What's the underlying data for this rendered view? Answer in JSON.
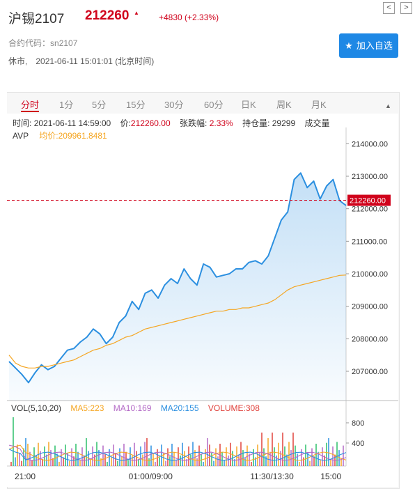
{
  "header": {
    "name": "沪锡2107",
    "price": "212260",
    "change": "+4830 (+2.33%)",
    "code_label": "合约代码：",
    "code": "sn2107",
    "status_text": "休市,",
    "datetime": "2021-06-11 15:01:01 (北京时间)",
    "add_button": "加入自选",
    "prev_arrow": "<",
    "next_arrow": ">"
  },
  "tabs": [
    "分时",
    "1分",
    "5分",
    "15分",
    "30分",
    "60分",
    "日K",
    "周K",
    "月K"
  ],
  "active_tab": "分时",
  "info_bar": {
    "time_label": "时间:",
    "time": "2021-06-11 14:59:00",
    "price_label": "价:",
    "price": "212260.00",
    "change_label": "张跌幅:",
    "change": "2.33%",
    "oi_label": "持仓量:",
    "oi": "29299",
    "vol_label": "成交量",
    "avp_label": "AVP",
    "avg_label": "均价:",
    "avg": "209961.8481"
  },
  "volume_legend": {
    "vol": "VOL(5,10,20)",
    "ma5": "MA5:223",
    "ma10": "MA10:169",
    "ma20": "MA20:155",
    "volume": "VOLUME:308"
  },
  "colors": {
    "up": "#d0021b",
    "price_line": "#2b8fe0",
    "avg_line": "#f5a623",
    "ma5": "#f5a623",
    "ma10": "#b36ac6",
    "ma20": "#2b8fe0",
    "volume_label": "#e0413b",
    "button": "#1e88e5"
  },
  "chart_data": {
    "type": "line",
    "ylim": [
      206100,
      214500
    ],
    "yticks": [
      "214000.00",
      "213000.00",
      "212000.00",
      "211000.00",
      "210000.00",
      "209000.00",
      "208000.00",
      "207000.00"
    ],
    "xticks": [
      "21:00",
      "01:00/09:00",
      "11:30/13:30",
      "15:00"
    ],
    "ref_label": "212260.00",
    "vol_ticks": [
      "800",
      "400"
    ],
    "series": [
      {
        "name": "价",
        "values": [
          207300,
          207100,
          206900,
          206650,
          206950,
          207200,
          207050,
          207150,
          207400,
          207650,
          207700,
          207900,
          208050,
          208300,
          208150,
          207850,
          208050,
          208500,
          208700,
          209150,
          208900,
          209400,
          209500,
          209250,
          209650,
          209850,
          209700,
          210150,
          209850,
          209650,
          210300,
          210200,
          209900,
          209950,
          210000,
          210150,
          210150,
          210350,
          210400,
          210300,
          210550,
          211100,
          211650,
          211900,
          212900,
          213100,
          212650,
          212850,
          212300,
          212700,
          212900,
          212250,
          212100
        ]
      },
      {
        "name": "均价",
        "values": [
          207500,
          207250,
          207150,
          207100,
          207100,
          207150,
          207150,
          207200,
          207250,
          207300,
          207350,
          207450,
          207550,
          207650,
          207700,
          207800,
          207850,
          207950,
          208050,
          208100,
          208200,
          208300,
          208350,
          208400,
          208450,
          208500,
          208550,
          208600,
          208650,
          208700,
          208750,
          208800,
          208850,
          208850,
          208900,
          208900,
          208950,
          208950,
          209000,
          209050,
          209100,
          209200,
          209350,
          209500,
          209600,
          209650,
          209700,
          209750,
          209800,
          209850,
          209900,
          209950,
          209962
        ]
      }
    ]
  }
}
